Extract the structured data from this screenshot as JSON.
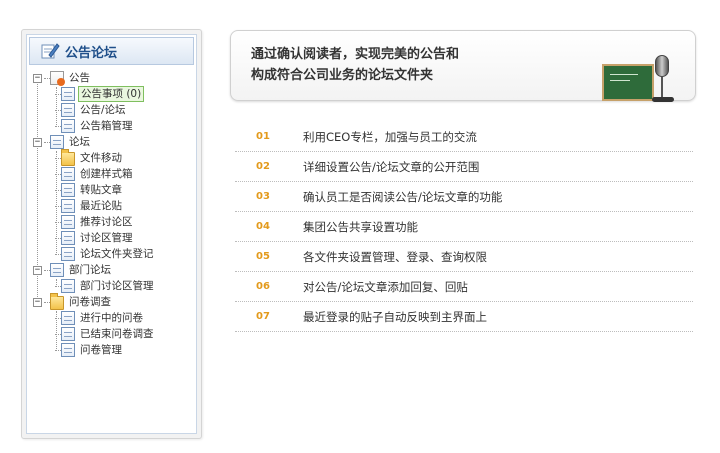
{
  "sidebar": {
    "title": "公告论坛",
    "tree": {
      "notice": {
        "toggle": "−",
        "label": "公告",
        "items": [
          "公告事项 (0)",
          "公告/论坛",
          "公告箱管理"
        ]
      },
      "forum": {
        "toggle": "−",
        "label": "论坛",
        "items": [
          "文件移动",
          "创建样式箱",
          "转贴文章",
          "最近论贴",
          "推荐讨论区",
          "讨论区管理",
          "论坛文件夹登记"
        ]
      },
      "dept_forum": {
        "toggle": "−",
        "label": "部门论坛",
        "items": [
          "部门讨论区管理"
        ]
      },
      "survey": {
        "toggle": "−",
        "label": "问卷调查",
        "items": [
          "进行中的问卷",
          "已结束问卷调查",
          "问卷管理"
        ]
      }
    }
  },
  "banner": {
    "line1": "通过确认阅读者，实现完美的公告和",
    "line2": "构成符合公司业务的论坛文件夹"
  },
  "features": [
    {
      "num": "01",
      "text": "利用CEO专栏，加强与员工的交流"
    },
    {
      "num": "02",
      "text": "详细设置公告/论坛文章的公开范围"
    },
    {
      "num": "03",
      "text": "确认员工是否阅读公告/论坛文章的功能"
    },
    {
      "num": "04",
      "text": "集团公告共享设置功能"
    },
    {
      "num": "05",
      "text": "各文件夹设置管理、登录、查询权限"
    },
    {
      "num": "06",
      "text": "对公告/论坛文章添加回复、回贴"
    },
    {
      "num": "07",
      "text": "最近登录的贴子自动反映到主界面上"
    }
  ],
  "colors": {
    "accent_number": "#e39a1c",
    "header_title": "#1f4f8a",
    "selected_border": "#7fbf5f"
  }
}
